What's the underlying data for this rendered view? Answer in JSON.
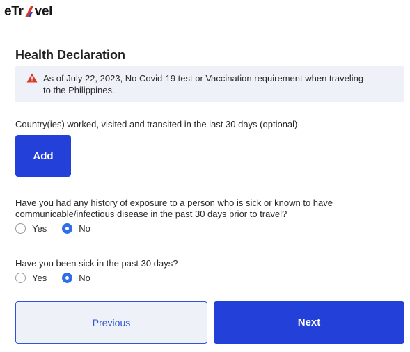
{
  "logo": {
    "text_start": "eTr",
    "text_end": "vel"
  },
  "page_title": "Health Declaration",
  "alert": {
    "text": "As of July 22, 2023, No Covid-19 test or Vaccination requirement when traveling to the Philippines.",
    "icon": "warning-icon",
    "icon_color": "#d83a2a"
  },
  "countries": {
    "question": "Country(ies) worked, visited and transited in the last 30 days (optional)",
    "add_label": "Add"
  },
  "exposure": {
    "question": "Have you had any history of exposure to a person who is sick or known to have communicable/infectious disease in the past 30 days prior to travel?",
    "options": [
      "Yes",
      "No"
    ],
    "selected": "No"
  },
  "sick": {
    "question": "Have you been sick in the past 30 days?",
    "options": [
      "Yes",
      "No"
    ],
    "selected": "No"
  },
  "nav": {
    "previous_label": "Previous",
    "next_label": "Next"
  },
  "colors": {
    "primary": "#2340d8",
    "radio_checked": "#2f6ee8",
    "alert_bg": "#eef1f8"
  }
}
